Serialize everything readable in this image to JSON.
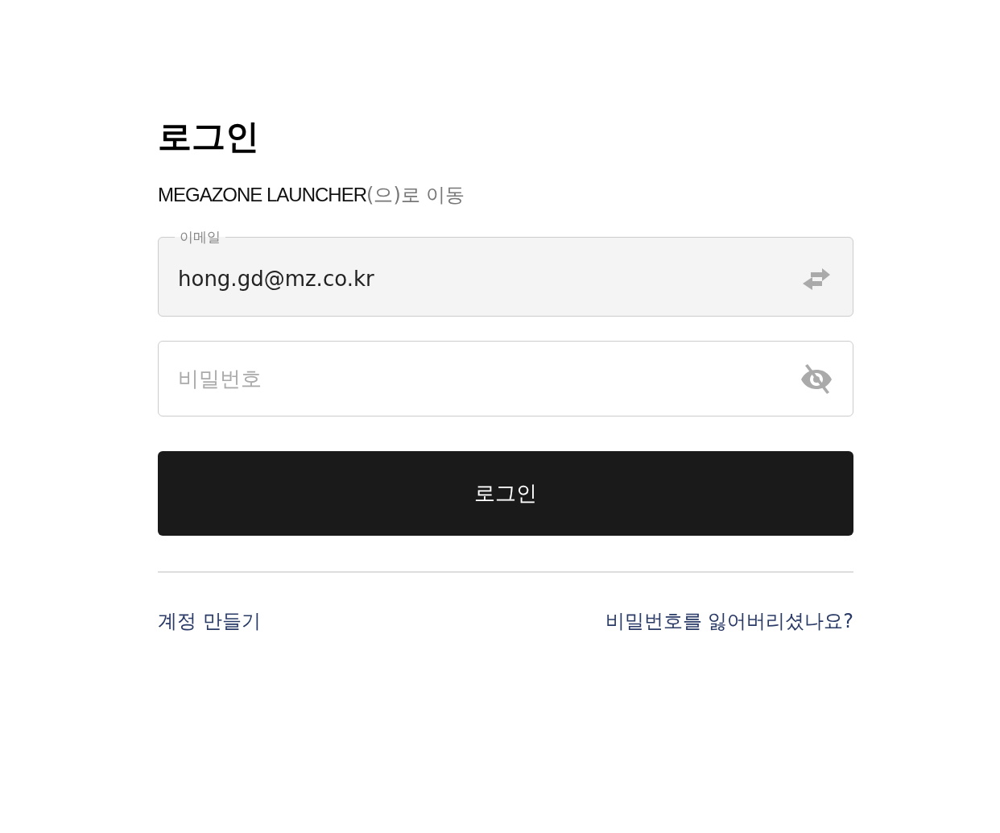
{
  "title": "로그인",
  "subtitle": {
    "app_name": "MEGAZONE LAUNCHER",
    "suffix": "(으)로 이동"
  },
  "fields": [
    {
      "kind": "email",
      "label": "이메일",
      "value": "hong.gd@mz.co.kr"
    },
    {
      "kind": "password",
      "placeholder": "비밀번호"
    }
  ],
  "submit_button": "로그인",
  "links": [
    {
      "label": "계정 만들기"
    },
    {
      "label": "비밀번호를 잃어버리셨나요?"
    }
  ]
}
